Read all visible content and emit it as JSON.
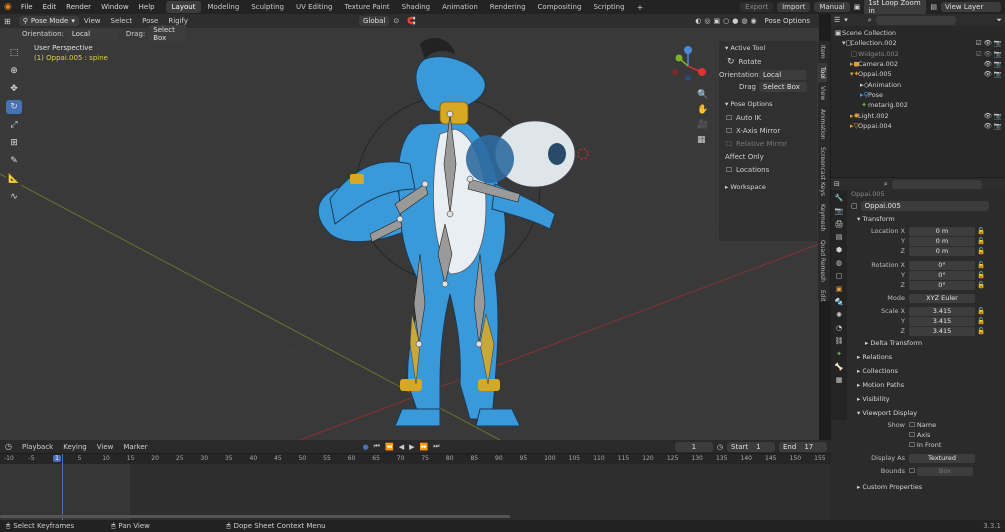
{
  "menu": [
    "File",
    "Edit",
    "Render",
    "Window",
    "Help"
  ],
  "workspaces": [
    "Layout",
    "Modeling",
    "Sculpting",
    "UV Editing",
    "Texture Paint",
    "Shading",
    "Animation",
    "Rendering",
    "Compositing",
    "Scripting"
  ],
  "topbar_right": {
    "export": "Export",
    "import": "Import",
    "manual": "Manual",
    "scene": "1st Loop Zoom in",
    "view_layer": "View Layer"
  },
  "viewport_header": {
    "mode": "Pose Mode",
    "menus": [
      "View",
      "Select",
      "Pose",
      "Rigify"
    ],
    "transform": "Global",
    "pose_options": "Pose Options"
  },
  "viewport_header2": {
    "orientation_label": "Orientation:",
    "orientation": "Local",
    "drag_label": "Drag:",
    "drag": "Select Box"
  },
  "viewport_info": {
    "perspective": "User Perspective",
    "object": "(1) Oppai.005 : spine"
  },
  "gizmo": {
    "x": "X",
    "y": "Y",
    "z": "Z"
  },
  "npanel": {
    "active_tool": "Active Tool",
    "tool_name": "Rotate",
    "orientation_label": "Orientation",
    "orientation": "Local",
    "drag_label": "Drag",
    "drag": "Select Box",
    "pose_options": "Pose Options",
    "auto_ik": "Auto IK",
    "x_axis_mirror": "X-Axis Mirror",
    "relative_mirror": "Relative Mirror",
    "affect_only": "Affect Only",
    "locations": "Locations",
    "workspace": "Workspace"
  },
  "ntabs": [
    "Item",
    "Tool",
    "View",
    "Animation",
    "Screencast Keys",
    "Keymesh",
    "Quad Remesh",
    "Edit"
  ],
  "outliner": {
    "scene_collection": "Scene Collection",
    "items": [
      {
        "name": "Collection.002",
        "indent": 1,
        "icon": "collection-icon"
      },
      {
        "name": "Widgets.002",
        "indent": 2,
        "icon": "collection-icon"
      },
      {
        "name": "Camera.002",
        "indent": 2,
        "icon": "camera-icon"
      },
      {
        "name": "Oppai.005",
        "indent": 2,
        "icon": "armature-icon"
      },
      {
        "name": "Animation",
        "indent": 3,
        "icon": "animation-icon"
      },
      {
        "name": "Pose",
        "indent": 3,
        "icon": "pose-icon"
      },
      {
        "name": "metarig.002",
        "indent": 3,
        "icon": "armature-icon"
      },
      {
        "name": "Light.002",
        "indent": 2,
        "icon": "light-icon"
      },
      {
        "name": "Oppai.004",
        "indent": 2,
        "icon": "mesh-icon"
      }
    ]
  },
  "properties": {
    "breadcrumb": "Oppai.005",
    "object_name": "Oppai.005",
    "transform": "Transform",
    "location": {
      "label": "Location X",
      "x": "0 m",
      "y": "0 m",
      "z": "0 m"
    },
    "rotation": {
      "label": "Rotation X",
      "x": "0°",
      "y": "0°",
      "z": "0°"
    },
    "mode_label": "Mode",
    "mode": "XYZ Euler",
    "scale": {
      "label": "Scale X",
      "x": "3.415",
      "y": "3.415",
      "z": "3.415"
    },
    "axis_y": "Y",
    "axis_z": "Z",
    "delta_transform": "Delta Transform",
    "relations": "Relations",
    "collections": "Collections",
    "motion_paths": "Motion Paths",
    "visibility": "Visibility",
    "viewport_display": "Viewport Display",
    "show_label": "Show",
    "show_name": "Name",
    "show_axis": "Axis",
    "show_in_front": "In Front",
    "display_as_label": "Display As",
    "display_as": "Textured",
    "bounds_label": "Bounds",
    "bounds": "Box",
    "custom_properties": "Custom Properties"
  },
  "timeline": {
    "menus": [
      "Playback",
      "Keying",
      "View",
      "Marker"
    ],
    "current_frame": "1",
    "start_label": "Start",
    "start": "1",
    "end_label": "End",
    "end": "17",
    "ruler": [
      "-10",
      "-5",
      "1",
      "5",
      "10",
      "15",
      "20",
      "25",
      "30",
      "35",
      "40",
      "45",
      "50",
      "55",
      "60",
      "65",
      "70",
      "75",
      "80",
      "85",
      "90",
      "95",
      "100",
      "105",
      "110",
      "115",
      "120",
      "125",
      "130",
      "135",
      "140",
      "145",
      "150",
      "155"
    ]
  },
  "status": {
    "select": "Select Keyframes",
    "pan": "Pan View",
    "context": "Dope Sheet Context Menu",
    "version": "3.3.1"
  },
  "colors": {
    "accent": "#4772b3",
    "viewport": "#393939",
    "body_blue": "#3a9ad9",
    "gold": "#d7a823",
    "playhead": "#4772b3"
  }
}
